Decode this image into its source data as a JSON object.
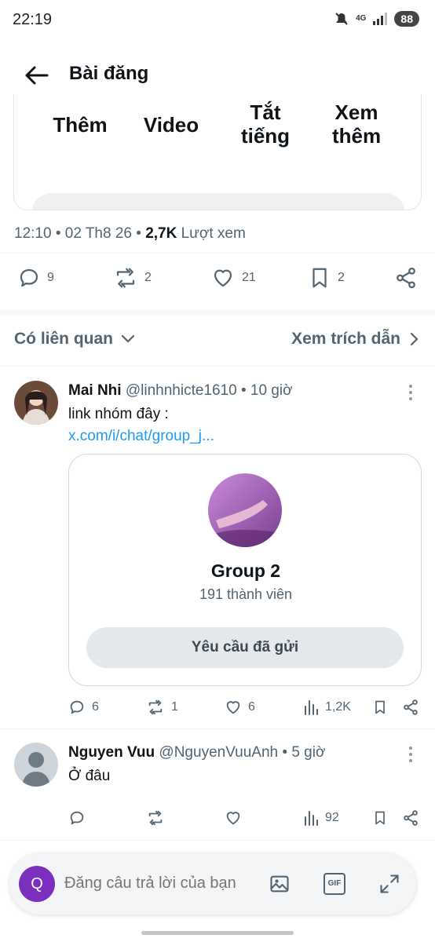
{
  "status_bar": {
    "time": "22:19",
    "network": "4G",
    "battery": "88"
  },
  "header": {
    "title": "Bài đăng"
  },
  "media_card": {
    "labels": [
      "Thêm",
      "Video",
      "Tắt tiếng",
      "Xem thêm"
    ]
  },
  "post_meta": {
    "time_date": "12:10 • 02 Th8 26 • ",
    "views_count": "2,7K",
    "views_label": " Lượt xem"
  },
  "post_actions": {
    "replies": "9",
    "reposts": "2",
    "likes": "21",
    "bookmarks": "2"
  },
  "sort_bar": {
    "left_label": "Có liên quan",
    "right_label": "Xem trích dẫn"
  },
  "replies": [
    {
      "name": "Mai Nhi",
      "handle_time": "@linhnhicte1610 • 10 giờ",
      "text": "link nhóm đây :",
      "link": "x.com/i/chat/group_j...",
      "group": {
        "name": "Group 2",
        "members": "191 thành viên",
        "button": "Yêu cầu đã gửi"
      },
      "actions": {
        "replies": "6",
        "reposts": "1",
        "likes": "6",
        "views": "1,2K"
      }
    },
    {
      "name": "Nguyen Vuu",
      "handle_time": "@NguyenVuuAnh • 5 giờ",
      "text": "Ở đâu",
      "actions": {
        "replies": "",
        "reposts": "",
        "likes": "",
        "views": "92"
      }
    }
  ],
  "composer": {
    "avatar_letter": "Q",
    "placeholder": "Đăng câu trả lời của bạn",
    "gif_label": "GIF"
  },
  "icons": [
    "back-arrow-icon",
    "reply-icon",
    "repost-icon",
    "like-icon",
    "bookmark-icon",
    "share-icon",
    "chevron-down-icon",
    "chevron-right-icon",
    "views-icon",
    "more-icon",
    "image-icon",
    "gif-icon",
    "expand-icon"
  ]
}
